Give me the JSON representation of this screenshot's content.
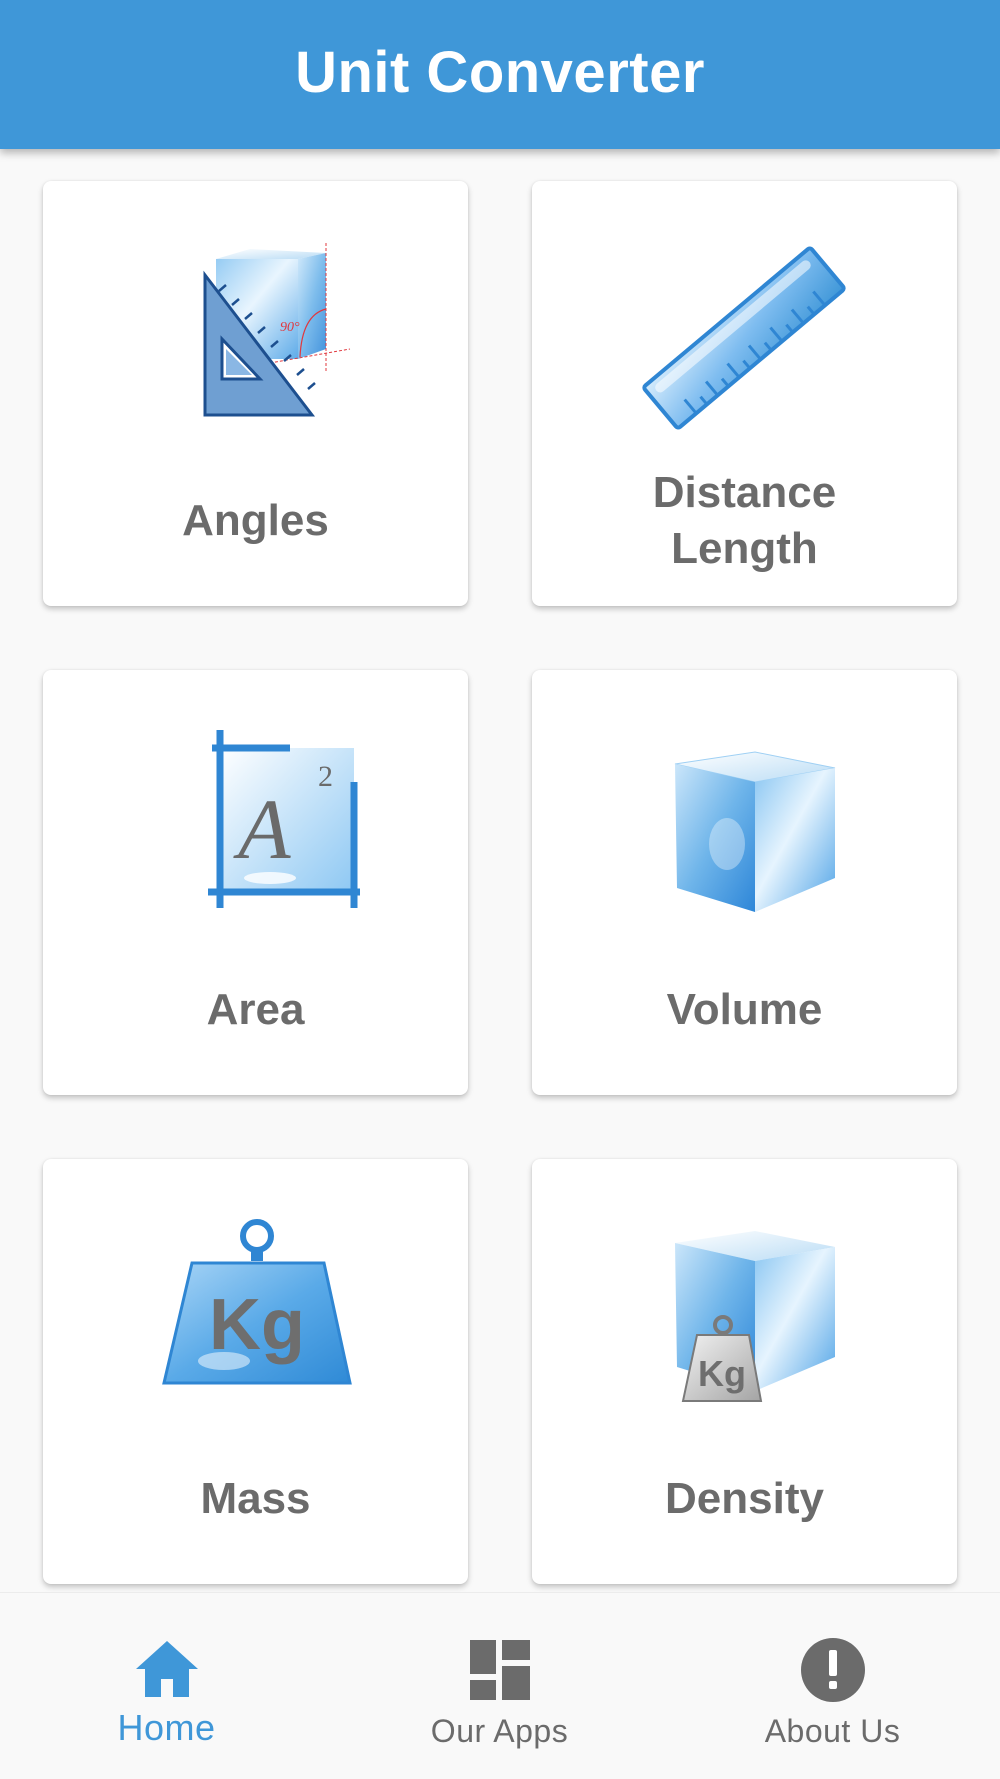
{
  "app": {
    "title": "Unit Converter",
    "accent_color": "#3f97d8"
  },
  "categories": [
    {
      "label": "Angles",
      "icon": "angles-icon"
    },
    {
      "label": "Distance\nLength",
      "icon": "ruler-icon"
    },
    {
      "label": "Area",
      "icon": "area-icon"
    },
    {
      "label": "Volume",
      "icon": "cube-icon"
    },
    {
      "label": "Mass",
      "icon": "weight-kg-icon"
    },
    {
      "label": "Density",
      "icon": "density-icon"
    }
  ],
  "bottom_nav": {
    "items": [
      {
        "label": "Home",
        "icon": "home-icon",
        "active": true
      },
      {
        "label": "Our Apps",
        "icon": "dashboard-icon",
        "active": false
      },
      {
        "label": "About Us",
        "icon": "info-alert-icon",
        "active": false
      }
    ]
  },
  "icon_text": {
    "angle_mark": "90°",
    "area_letter": "A",
    "area_exponent": "2",
    "mass_unit": "Kg"
  }
}
